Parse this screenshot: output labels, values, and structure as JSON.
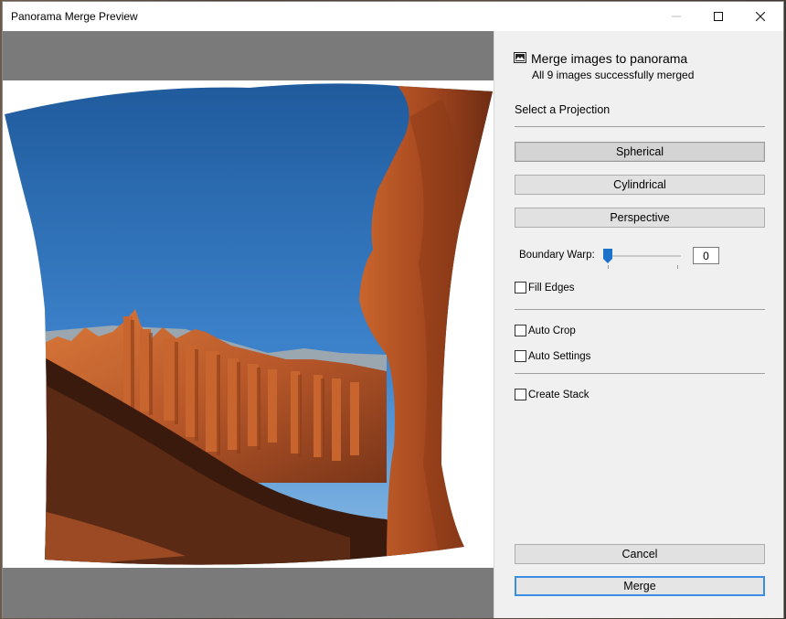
{
  "window": {
    "title": "Panorama Merge Preview"
  },
  "header": {
    "title": "Merge images to panorama",
    "subtitle": "All 9 images successfully merged",
    "icon": "image-icon"
  },
  "projection": {
    "section_label": "Select a Projection",
    "options": [
      {
        "label": "Spherical",
        "selected": true
      },
      {
        "label": "Cylindrical",
        "selected": false
      },
      {
        "label": "Perspective",
        "selected": false
      }
    ]
  },
  "boundary_warp": {
    "label": "Boundary Warp:",
    "value": "0"
  },
  "options": {
    "fill_edges": {
      "label": "Fill Edges",
      "checked": false
    },
    "auto_crop": {
      "label": "Auto Crop",
      "checked": false
    },
    "auto_settings": {
      "label": "Auto Settings",
      "checked": false
    },
    "create_stack": {
      "label": "Create Stack",
      "checked": false
    }
  },
  "actions": {
    "cancel_label": "Cancel",
    "merge_label": "Merge"
  },
  "colors": {
    "accent": "#3d8ee0",
    "slider_thumb": "#1a73c8"
  }
}
